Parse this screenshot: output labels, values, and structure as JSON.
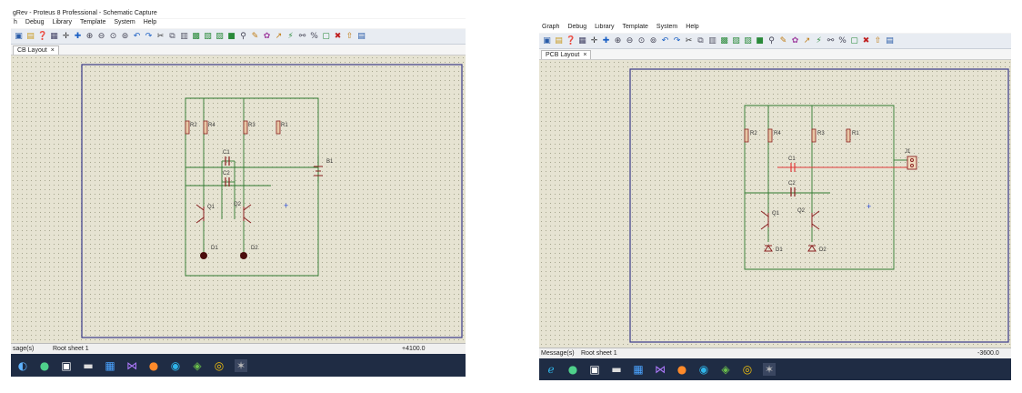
{
  "left": {
    "title": "gRev - Proteus 8 Professional - Schematic Capture",
    "menu": [
      "h",
      "Debug",
      "Library",
      "Template",
      "System",
      "Help"
    ],
    "tab": {
      "label": "CB Layout",
      "close": "×"
    },
    "status": {
      "messages": "sage(s)",
      "sheet": "Root sheet 1",
      "coord": "+4100.0"
    },
    "components": {
      "r2": "R2",
      "r4": "R4",
      "r3": "R3",
      "r1": "R1",
      "c1": "C1",
      "c2": "C2",
      "q1": "Q1",
      "q2": "Q2",
      "d1": "D1",
      "d2": "D2",
      "b1": "B1"
    }
  },
  "right": {
    "menu": [
      "Graph",
      "Debug",
      "Library",
      "Template",
      "System",
      "Help"
    ],
    "tab": {
      "label": "PCB Layout",
      "close": "×"
    },
    "status": {
      "messages": "Message(s)",
      "sheet": "Root sheet 1",
      "coord": "-3600.0"
    },
    "components": {
      "r2": "R2",
      "r4": "R4",
      "r3": "R3",
      "r1": "R1",
      "c1": "C1",
      "c2": "C2",
      "q1": "Q1",
      "q2": "Q2",
      "d1": "D1",
      "d2": "D2",
      "j1": "J1"
    }
  },
  "icons": {
    "toolbar": [
      "new-file-icon",
      "open-file-icon",
      "help-icon",
      "grid-icon",
      "origin-icon",
      "pan-icon",
      "zoom-in-icon",
      "zoom-out-icon",
      "zoom-all-icon",
      "zoom-area-icon",
      "undo-icon",
      "redo-icon",
      "cut-icon",
      "copy-icon",
      "paste-icon",
      "block-copy-icon",
      "block-move-icon",
      "block-rotate-icon",
      "block-delete-icon",
      "pick-device-icon",
      "make-device-icon",
      "packaging-icon",
      "decompose-icon",
      "wire-autorouter-icon",
      "search-icon",
      "property-tool-icon",
      "new-sheet-icon",
      "remove-sheet-icon",
      "exit-sheet-icon",
      "bom-icon"
    ],
    "taskbar": [
      "start-icon",
      "search-icon",
      "store-icon",
      "explorer-icon",
      "terminal-icon",
      "visual-studio-icon",
      "firefox-icon",
      "edge-icon",
      "proteus-icon",
      "chrome-icon",
      "pcb-app-icon"
    ]
  },
  "colors": {
    "wire": "#2f7a2f",
    "component": "#8a1f1f",
    "highlight": "#e23b3b",
    "taskbar": "#1f2c44"
  }
}
